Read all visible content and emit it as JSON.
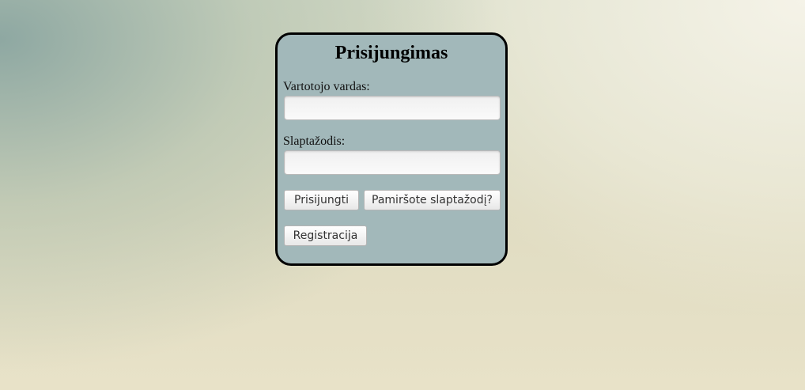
{
  "login": {
    "title": "Prisijungimas",
    "username_label": "Vartotojo vardas:",
    "username_value": "",
    "password_label": "Slaptažodis:",
    "password_value": "",
    "login_button": "Prisijungti",
    "forgot_button": "Pamiršote slaptažodį?",
    "register_button": "Registracija"
  },
  "colors": {
    "panel_background": "#a2b8ba",
    "panel_border": "#000000"
  }
}
